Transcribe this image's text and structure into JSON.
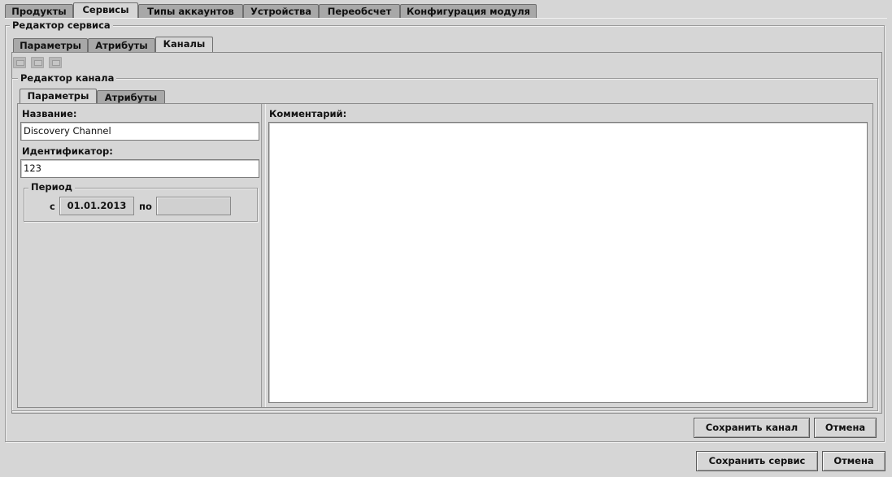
{
  "top_tabs": [
    "Продукты",
    "Сервисы",
    "Типы аккаунтов",
    "Устройства",
    "Переобсчет",
    "Конфигурация модуля"
  ],
  "active_top_tab": "Сервисы",
  "service_editor": {
    "title": "Редактор сервиса",
    "tabs": [
      "Параметры",
      "Атрибуты",
      "Каналы"
    ],
    "active_tab": "Каналы",
    "toolbar_icons": [
      "add-icon",
      "edit-icon",
      "delete-icon"
    ],
    "channel_editor": {
      "title": "Редактор канала",
      "tabs": [
        "Параметры",
        "Атрибуты"
      ],
      "active_tab": "Параметры",
      "name_label": "Название:",
      "name_value": "Discovery Channel",
      "id_label": "Идентификатор:",
      "id_value": "123",
      "period": {
        "title": "Период",
        "from_label": "с",
        "from_value": "01.01.2013",
        "to_label": "по",
        "to_value": ""
      },
      "comment_label": "Комментарий:",
      "comment_value": ""
    },
    "save_channel_label": "Сохранить канал",
    "cancel_channel_label": "Отмена"
  },
  "save_service_label": "Сохранить сервис",
  "cancel_service_label": "Отмена"
}
